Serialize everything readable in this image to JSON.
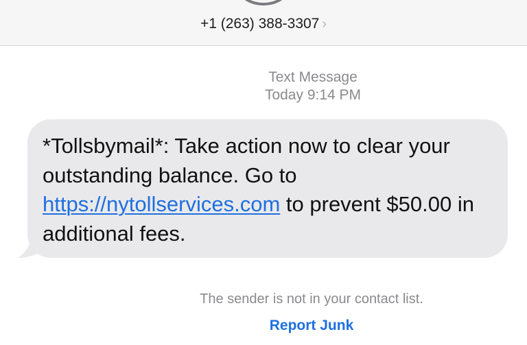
{
  "header": {
    "contact_number": "+1 (263) 388-3307",
    "chevron_icon": "chevron-right-icon"
  },
  "conversation": {
    "message_type": "Text Message",
    "timestamp": "Today 9:14 PM"
  },
  "message": {
    "text_before_link": "*Tollsbymail*: Take action now to clear your outstanding balance. Go to ",
    "link_text": "https://nytollservices.com",
    "text_after_link": " to prevent $50.00 in additional fees."
  },
  "footer": {
    "notice": "The sender is not in your contact list.",
    "report_label": "Report Junk"
  },
  "colors": {
    "accent": "#1e6fe0",
    "bubble": "#e9e9eb",
    "meta_text": "#8a8a8e",
    "header_bg": "#f6f6f7"
  }
}
